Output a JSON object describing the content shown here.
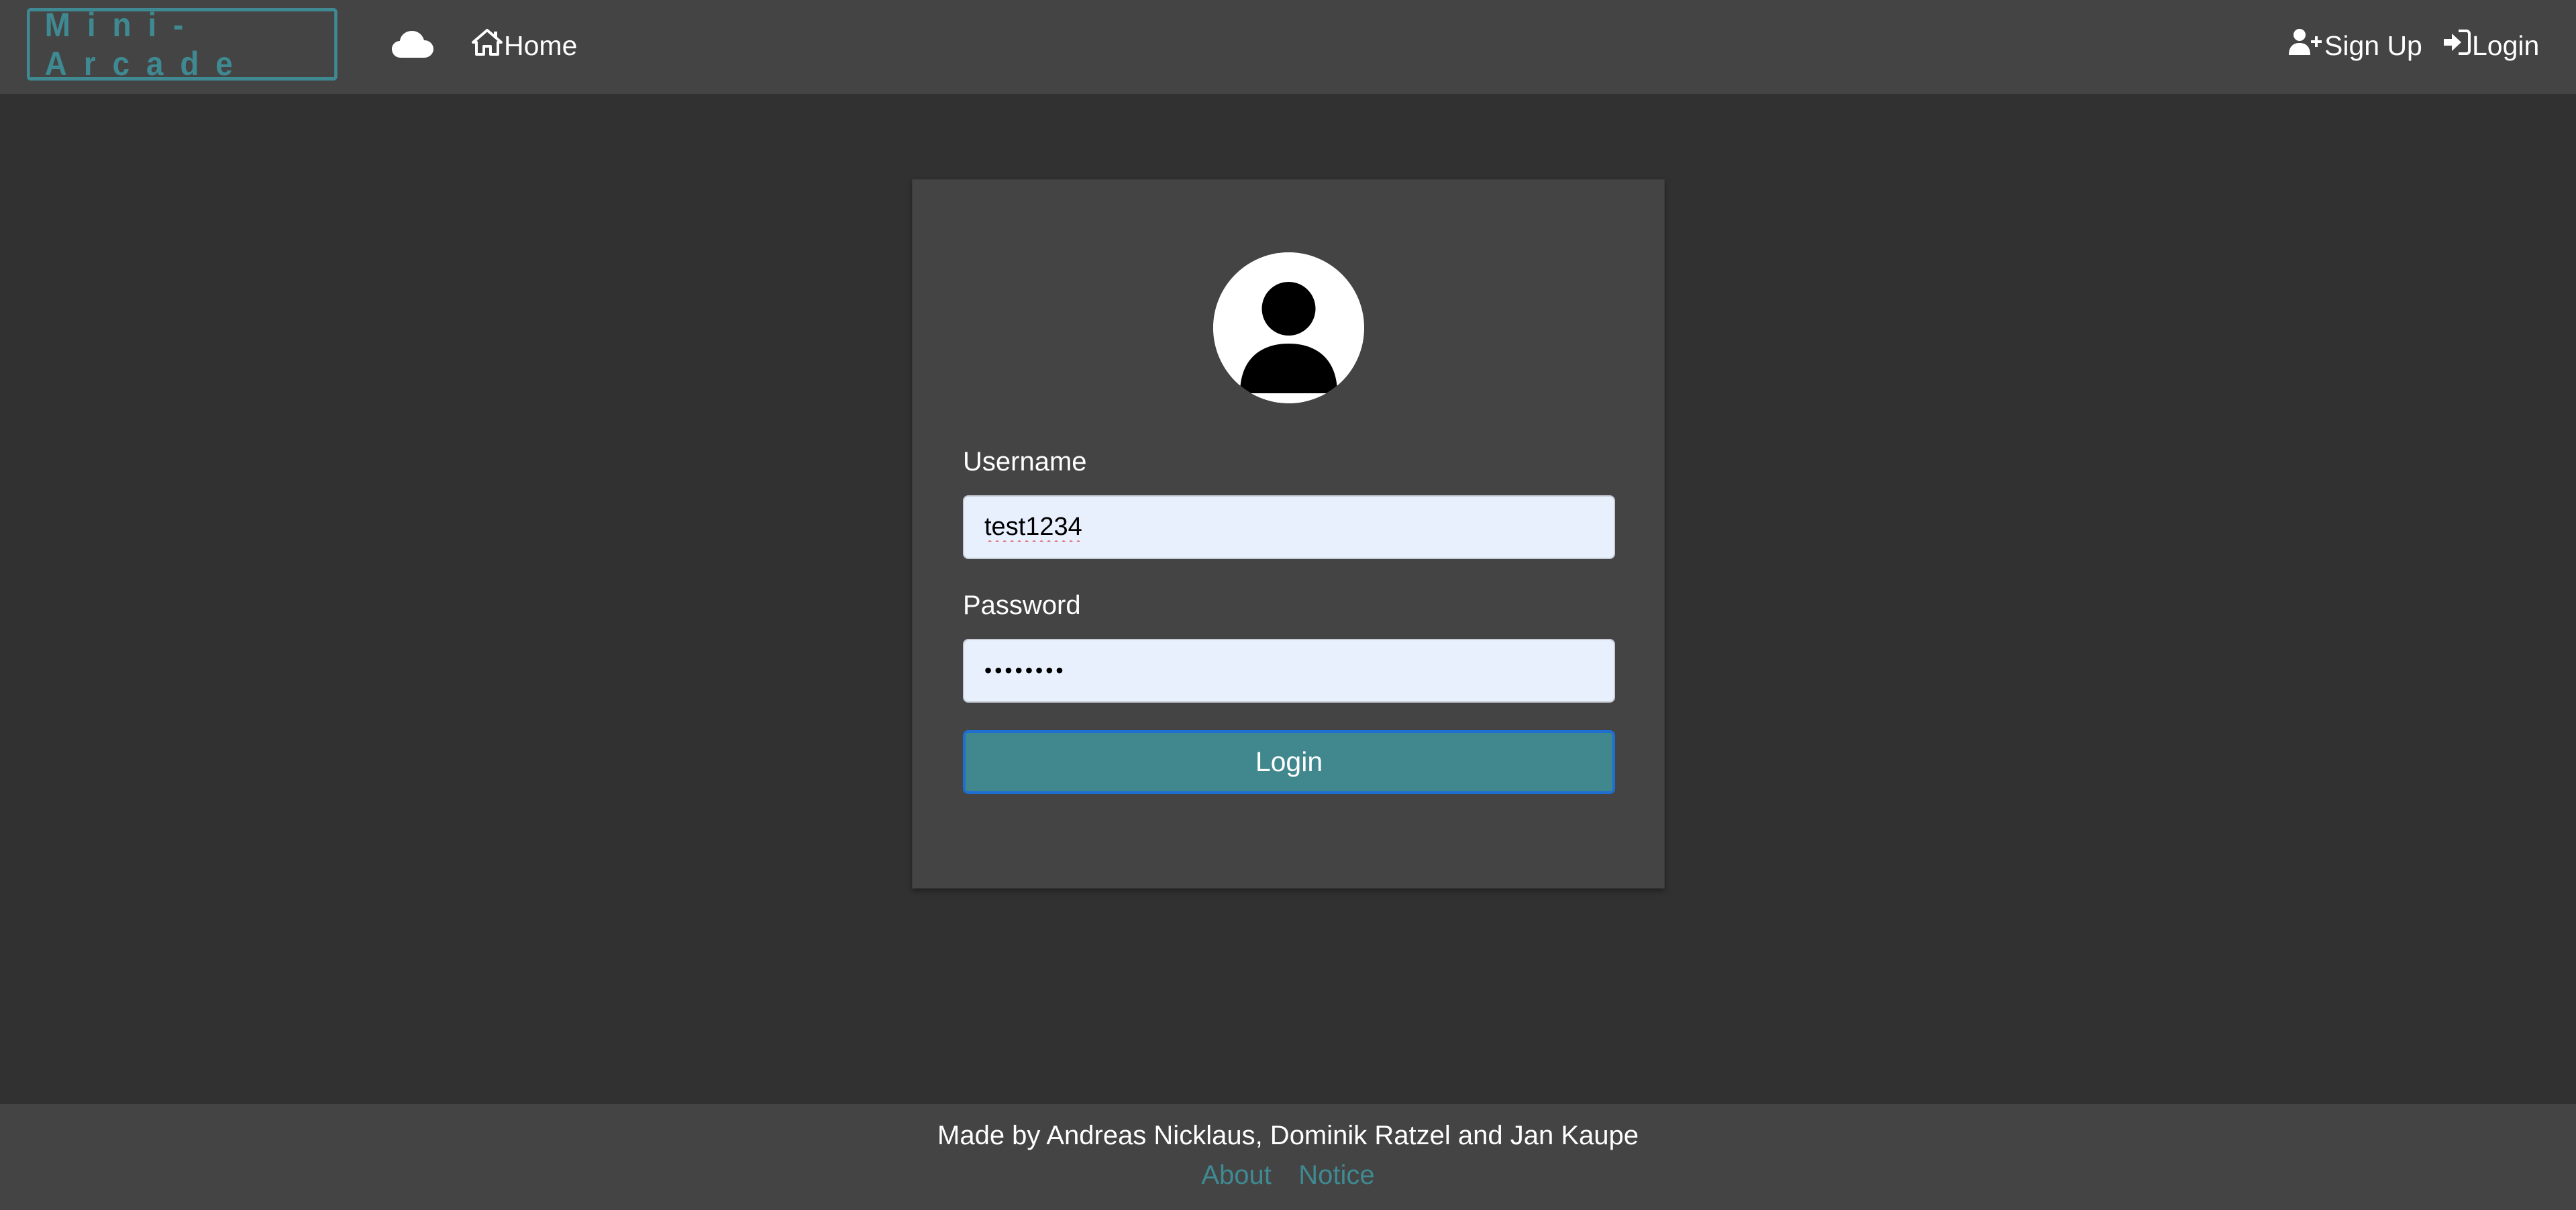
{
  "navbar": {
    "brand": "Mini-Arcade",
    "home_label": "Home",
    "signup_label": "Sign Up",
    "login_label": "Login",
    "icons": {
      "cloud": "cloud-icon",
      "home": "home-icon",
      "signup": "user-plus-icon",
      "login": "sign-in-icon"
    }
  },
  "login_form": {
    "avatar_icon": "user-avatar-icon",
    "username_label": "Username",
    "username_value": "test1234",
    "password_label": "Password",
    "password_value": "••••••••",
    "submit_label": "Login"
  },
  "footer": {
    "credit": "Made by Andreas Nicklaus, Dominik Ratzel and Jan Kaupe",
    "links": [
      "About",
      "Notice"
    ]
  },
  "colors": {
    "background": "#313131",
    "navbar": "#444444",
    "accent": "#3f8a92",
    "input_bg": "#e8f0fe",
    "button": "#41878e"
  }
}
